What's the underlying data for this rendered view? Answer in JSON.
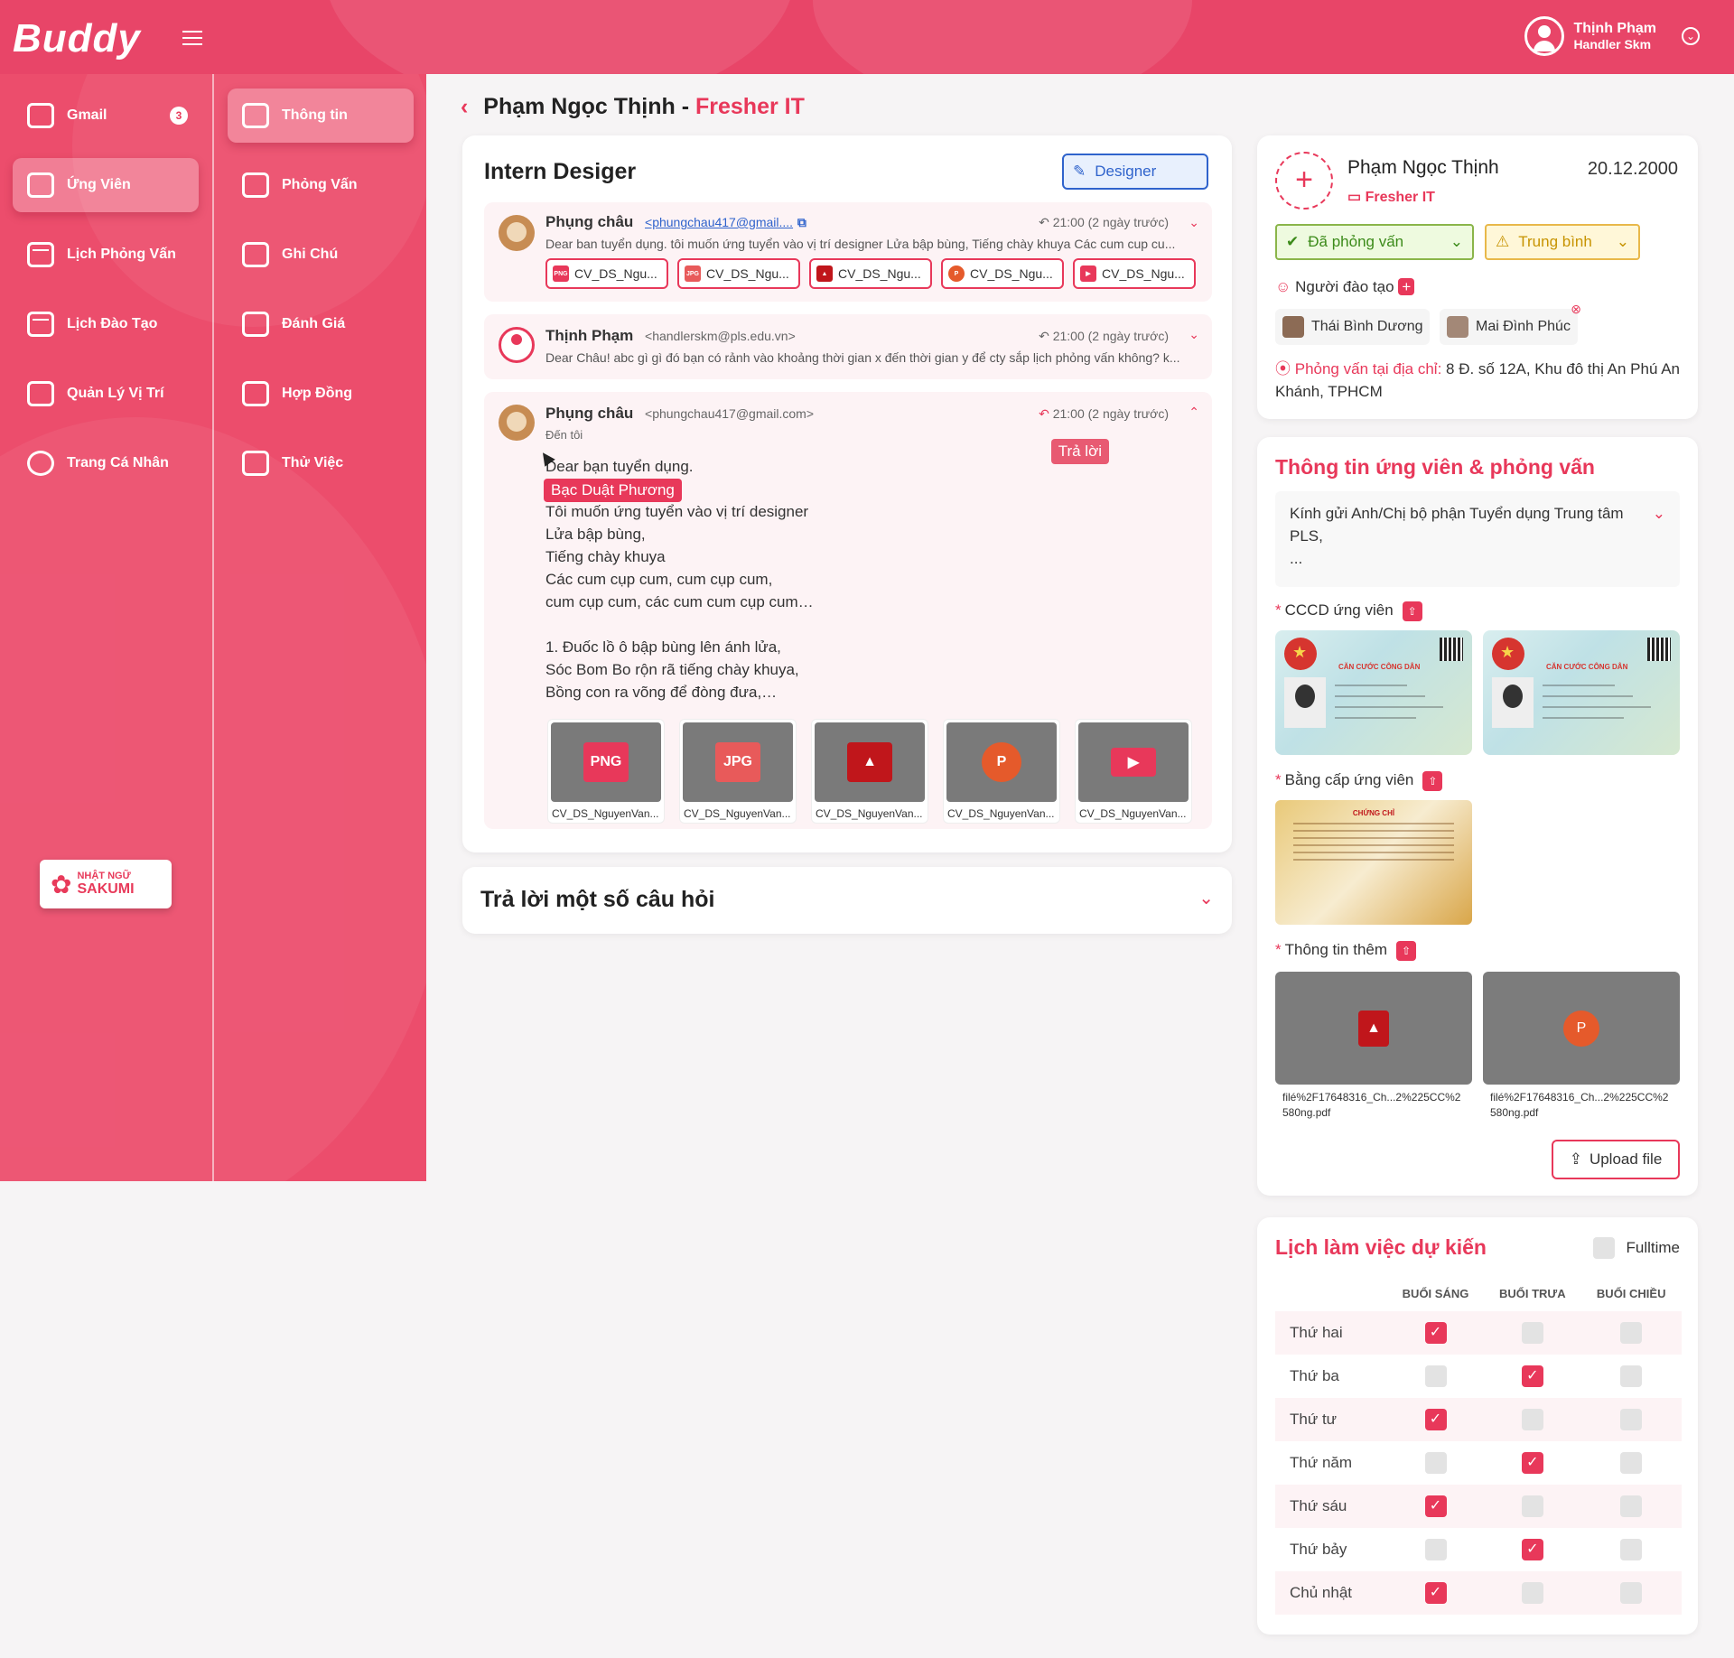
{
  "header": {
    "logo": "Buddy",
    "user_name": "Thịnh Phạm",
    "user_role": "Handler Skm"
  },
  "sidebar": {
    "primary": [
      {
        "label": "Gmail",
        "icon": "mail-icon",
        "badge": "3"
      },
      {
        "label": "Ứng Viên",
        "icon": "candidate-card-icon",
        "active": true
      },
      {
        "label": "Lịch Phỏng Vấn",
        "icon": "calendar-icon"
      },
      {
        "label": "Lịch Đào Tạo",
        "icon": "calendar-icon"
      },
      {
        "label": "Quản Lý Vị Trí",
        "icon": "position-list-icon"
      },
      {
        "label": "Trang Cá Nhân",
        "icon": "user-circle-icon"
      }
    ],
    "secondary": [
      {
        "label": "Thông tin",
        "icon": "info-card-icon",
        "active": true
      },
      {
        "label": "Phỏng Vấn",
        "icon": "interview-icon"
      },
      {
        "label": "Ghi Chú",
        "icon": "note-icon"
      },
      {
        "label": "Đánh Giá",
        "icon": "review-quote-icon"
      },
      {
        "label": "Hợp Đồng",
        "icon": "contract-icon"
      },
      {
        "label": "Thử Việc",
        "icon": "briefcase-icon"
      }
    ],
    "promo": {
      "line1": "NHẬT NGỮ",
      "line2": "SAKUMI"
    }
  },
  "page": {
    "candidate_name": "Phạm Ngọc Thịnh",
    "separator": " - ",
    "role": "Fresher IT"
  },
  "email_card": {
    "title": "Intern Desiger",
    "tag": "Designer",
    "emails": [
      {
        "sender": "Phụng châu",
        "email": "<phungchau417@gmail....",
        "time": "21:00 (2 ngày trước)",
        "snippet": "Dear ban tuyển dụng. tôi muốn ứng tuyển vào vị trí designer   Lửa bập bùng, Tiếng chày khuya Các cum cup cu...",
        "chips": [
          "CV_DS_Ngu...",
          "CV_DS_Ngu...",
          "CV_DS_Ngu...",
          "CV_DS_Ngu...",
          "CV_DS_Ngu..."
        ]
      },
      {
        "sender": "Thịnh Phạm",
        "email": "<handlerskm@pls.edu.vn>",
        "time": "21:00 (2 ngày trước)",
        "snippet": "Dear Châu! abc gì gì đó bạn có rảnh vào khoảng thời gian x đến thời gian y để cty sắp lịch phỏng vấn không? k..."
      },
      {
        "sender": "Phụng châu",
        "email": "<phungchau417@gmail.com>",
        "time": "21:00 (2 ngày trước)",
        "to": "Đến tôi",
        "body": "Dear bạn tuyển dụng.\n\nTôi muốn ứng tuyển vào vị trí designer\nLửa bập bùng,\nTiếng chày khuya\nCác cum cụp cum, cum cụp cum,\ncum cụp cum, các cum cum cụp cum…\n\n1. Đuốc lồ ô bập bùng lên ánh lửa,\nSóc Bom Bo rộn rã tiếng chày khuya,\nBồng con ra võng để đòng đưa,…",
        "tooltip": "Bạc Duật Phương",
        "reply_tooltip": "Trả lời",
        "attachments": [
          "CV_DS_NguyenVan...",
          "CV_DS_NguyenVan...",
          "CV_DS_NguyenVan...",
          "CV_DS_NguyenVan...",
          "CV_DS_NguyenVan..."
        ],
        "attachment_icons": [
          "PNG",
          "JPG",
          "pdf-icon",
          "powerpoint-icon",
          "video-icon"
        ]
      }
    ]
  },
  "questions": {
    "title": "Trả lời một số câu hỏi"
  },
  "profile": {
    "name": "Phạm Ngọc Thịnh",
    "dob": "20.12.2000",
    "role": "Fresher IT",
    "status": "Đã phỏng vấn",
    "level": "Trung bình",
    "trainer_label": "Người đào tạo",
    "trainers": [
      "Thái Bình Dương",
      "Mai Đình Phúc"
    ],
    "address_label": "Phỏng vấn tại địa chỉ:",
    "address": "8 Đ. số 12A, Khu đô thị An Phú An Khánh, TPHCM"
  },
  "info": {
    "title": "Thông tin ứng viên & phỏng vấn",
    "message": "Kính gửi Anh/Chị bộ phận Tuyển dụng Trung tâm PLS,",
    "ellipsis": "...",
    "cccd_label": "CCCD ứng viên",
    "id_card_title": "CĂN CƯỚC CÔNG DÂN",
    "degree_label": "Bằng cấp ứng viên",
    "degree_title": "CHỨNG CHỈ",
    "extra_label": "Thông tin thêm",
    "extra_files": [
      "filé%2F17648316_Ch...2%225CC%2580ng.pdf",
      "filé%2F17648316_Ch...2%225CC%2580ng.pdf"
    ],
    "upload_label": "Upload file"
  },
  "schedule": {
    "title": "Lịch làm việc dự kiến",
    "fulltime_label": "Fulltime",
    "columns": [
      "BUỔI SÁNG",
      "BUỔI TRƯA",
      "BUỔI CHIỀU"
    ],
    "rows": [
      {
        "day": "Thứ hai",
        "values": [
          true,
          false,
          false
        ]
      },
      {
        "day": "Thứ ba",
        "values": [
          false,
          true,
          false
        ]
      },
      {
        "day": "Thứ tư",
        "values": [
          true,
          false,
          false
        ]
      },
      {
        "day": "Thứ năm",
        "values": [
          false,
          true,
          false
        ]
      },
      {
        "day": "Thứ sáu",
        "values": [
          true,
          false,
          false
        ]
      },
      {
        "day": "Thứ bảy",
        "values": [
          false,
          true,
          false
        ]
      },
      {
        "day": "Chủ nhật",
        "values": [
          true,
          false,
          false
        ]
      }
    ]
  },
  "colors": {
    "primary": "#e8385a",
    "sidebar": "#ec4d6c",
    "green": "#3c8b1a",
    "yellow": "#c79300",
    "blue": "#2f63cc"
  }
}
